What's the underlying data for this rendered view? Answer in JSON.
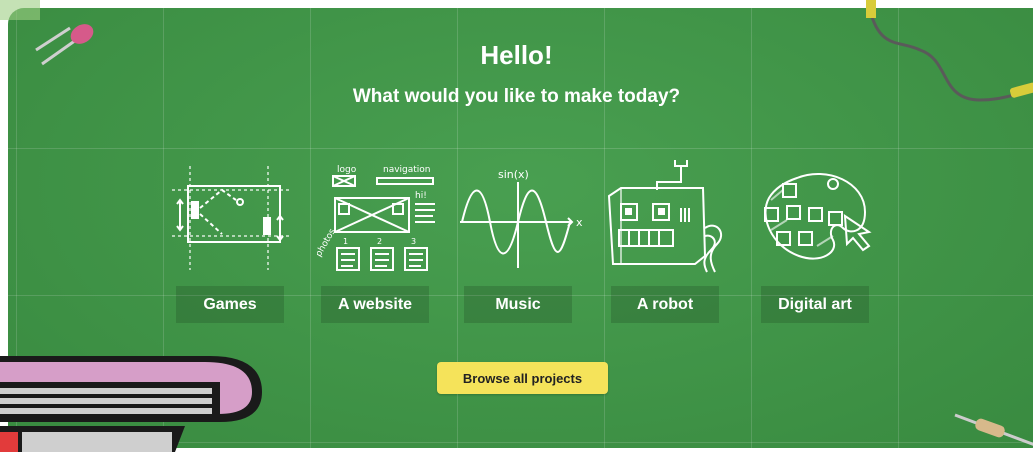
{
  "header": {
    "title": "Hello!",
    "subtitle": "What would you like to make today?"
  },
  "categories": [
    {
      "label": "Games",
      "icon": "games-sketch-icon"
    },
    {
      "label": "A website",
      "icon": "website-sketch-icon"
    },
    {
      "label": "Music",
      "icon": "sine-wave-sketch-icon"
    },
    {
      "label": "A robot",
      "icon": "robot-sketch-icon"
    },
    {
      "label": "Digital art",
      "icon": "palette-sketch-icon"
    }
  ],
  "sketch_text": {
    "logo": "logo",
    "navigation": "navigation",
    "photos": "photos",
    "hi": "hi!",
    "sin": "sin(x)",
    "x_axis": "x",
    "n1": "1",
    "n2": "2",
    "n3": "3"
  },
  "browse_button": "Browse all projects",
  "colors": {
    "board": "#3f9a47",
    "button": "#f5e35a",
    "book_cover": "#d69ec8",
    "book_red": "#e23b3b"
  }
}
